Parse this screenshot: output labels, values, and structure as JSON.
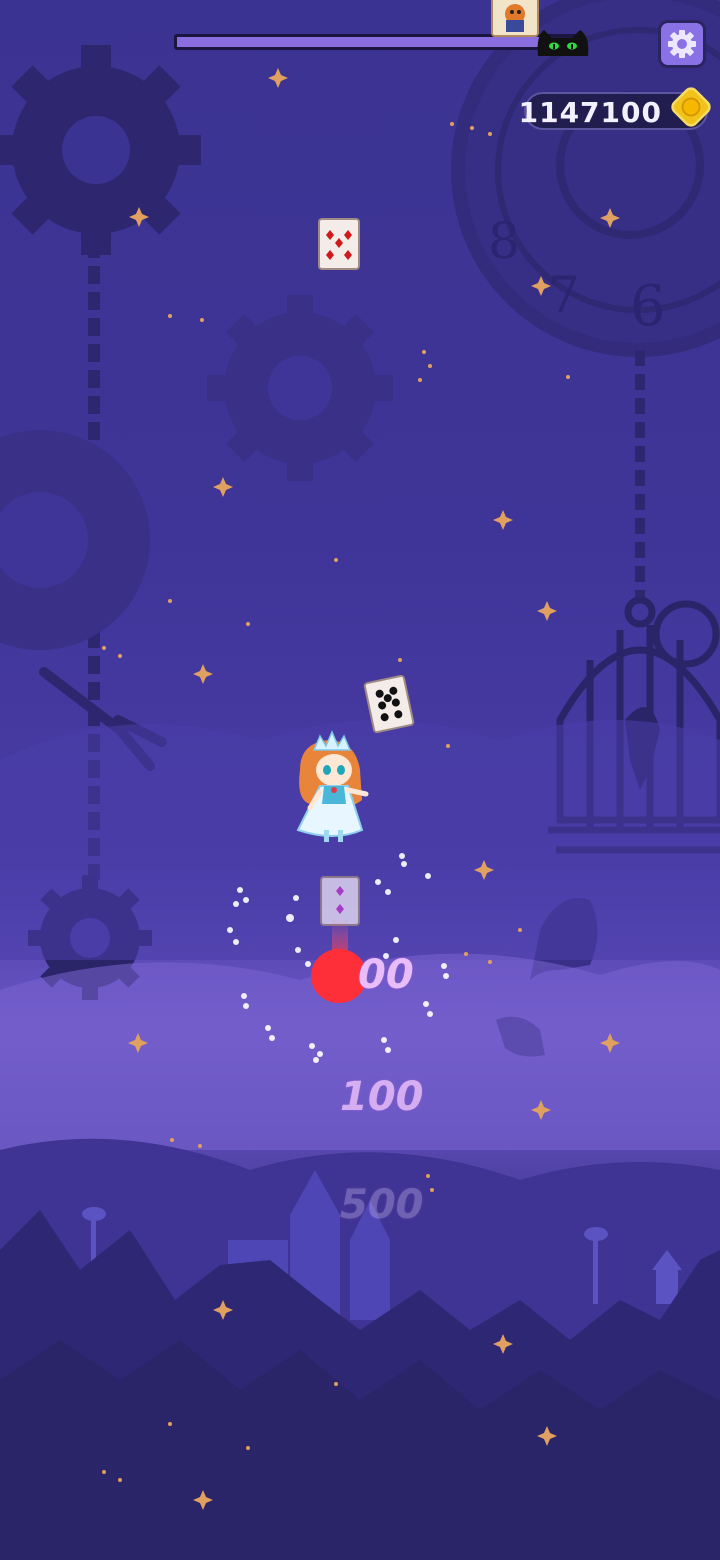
{
  "hud": {
    "level_progress": 0.9,
    "coins": "1147100",
    "settings_icon": "gear-icon",
    "coin_icon": "gold-coin-icon",
    "opponent_icon": "black-cat-icon",
    "goal_icon": "goal-card-icon"
  },
  "score_popups": [
    "00",
    "100",
    "500"
  ],
  "colors": {
    "progress_fill": "#8a6ee0",
    "settings_bg": "#8a72e6",
    "coin_gold": "#f0c21a",
    "score_pink": "#e8bdfa",
    "hit_red": "#ff2f3a"
  }
}
